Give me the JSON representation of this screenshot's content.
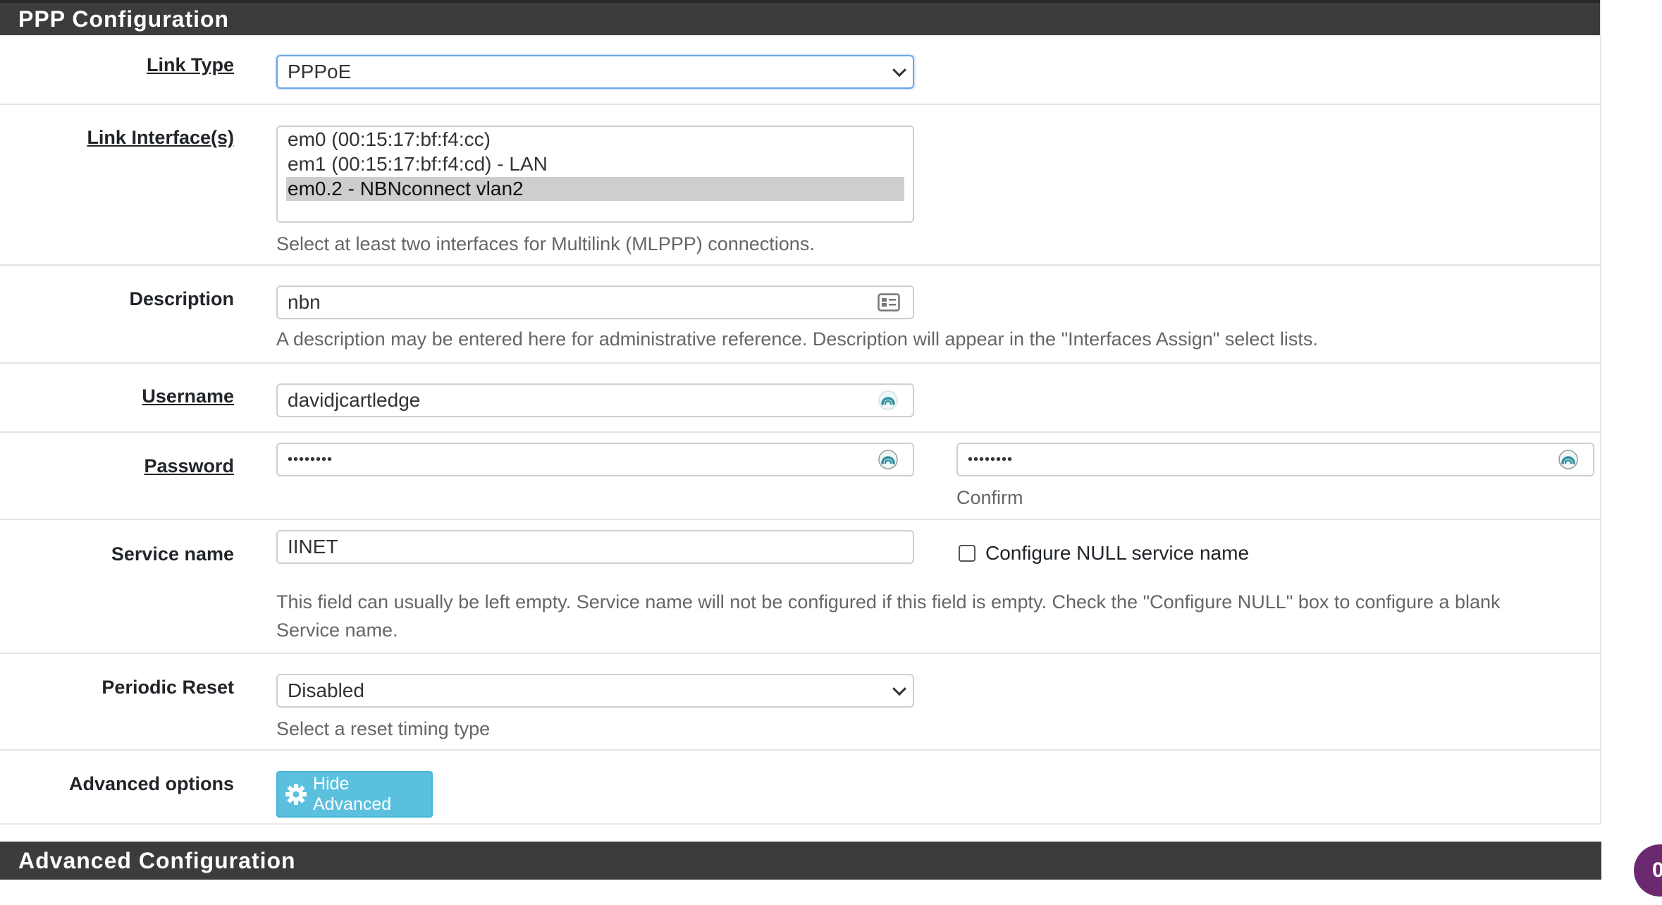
{
  "ppp_panel": {
    "title": "PPP Configuration"
  },
  "advanced_panel": {
    "title": "Advanced Configuration"
  },
  "link_type": {
    "label": "Link Type",
    "selected": "PPPoE"
  },
  "link_interfaces": {
    "label": "Link Interface(s)",
    "options": [
      {
        "text": "em0 (00:15:17:bf:f4:cc)",
        "selected": false
      },
      {
        "text": "em1 (00:15:17:bf:f4:cd) - LAN",
        "selected": false
      },
      {
        "text": "em0.2 - NBNconnect vlan2",
        "selected": true
      }
    ],
    "help": "Select at least two interfaces for Multilink (MLPPP) connections."
  },
  "description": {
    "label": "Description",
    "value": "nbn",
    "help": "A description may be entered here for administrative reference. Description will appear in the \"Interfaces Assign\" select lists."
  },
  "username": {
    "label": "Username",
    "value": "davidjcartledge"
  },
  "password": {
    "label": "Password",
    "value": "••••••••",
    "confirm_value": "••••••••",
    "confirm_label": "Confirm"
  },
  "service_name": {
    "label": "Service name",
    "value": "IINET",
    "null_checkbox_label": "Configure NULL service name",
    "null_checked": false,
    "help_line1": "This field can usually be left empty. Service name will not be configured if this field is empty. Check the \"Configure NULL\" box to configure a blank",
    "help_line2": "Service name."
  },
  "periodic_reset": {
    "label": "Periodic Reset",
    "selected": "Disabled",
    "help": "Select a reset timing type"
  },
  "advanced_options": {
    "label": "Advanced options",
    "button_label": "Hide Advanced"
  },
  "chat_badge": {
    "text": "0"
  },
  "colors": {
    "heading_bg": "#3c3c3c",
    "info_button": "#5bc0de",
    "chat_badge": "#6b2a6f",
    "keepass_icon": "#2f8f9d"
  }
}
